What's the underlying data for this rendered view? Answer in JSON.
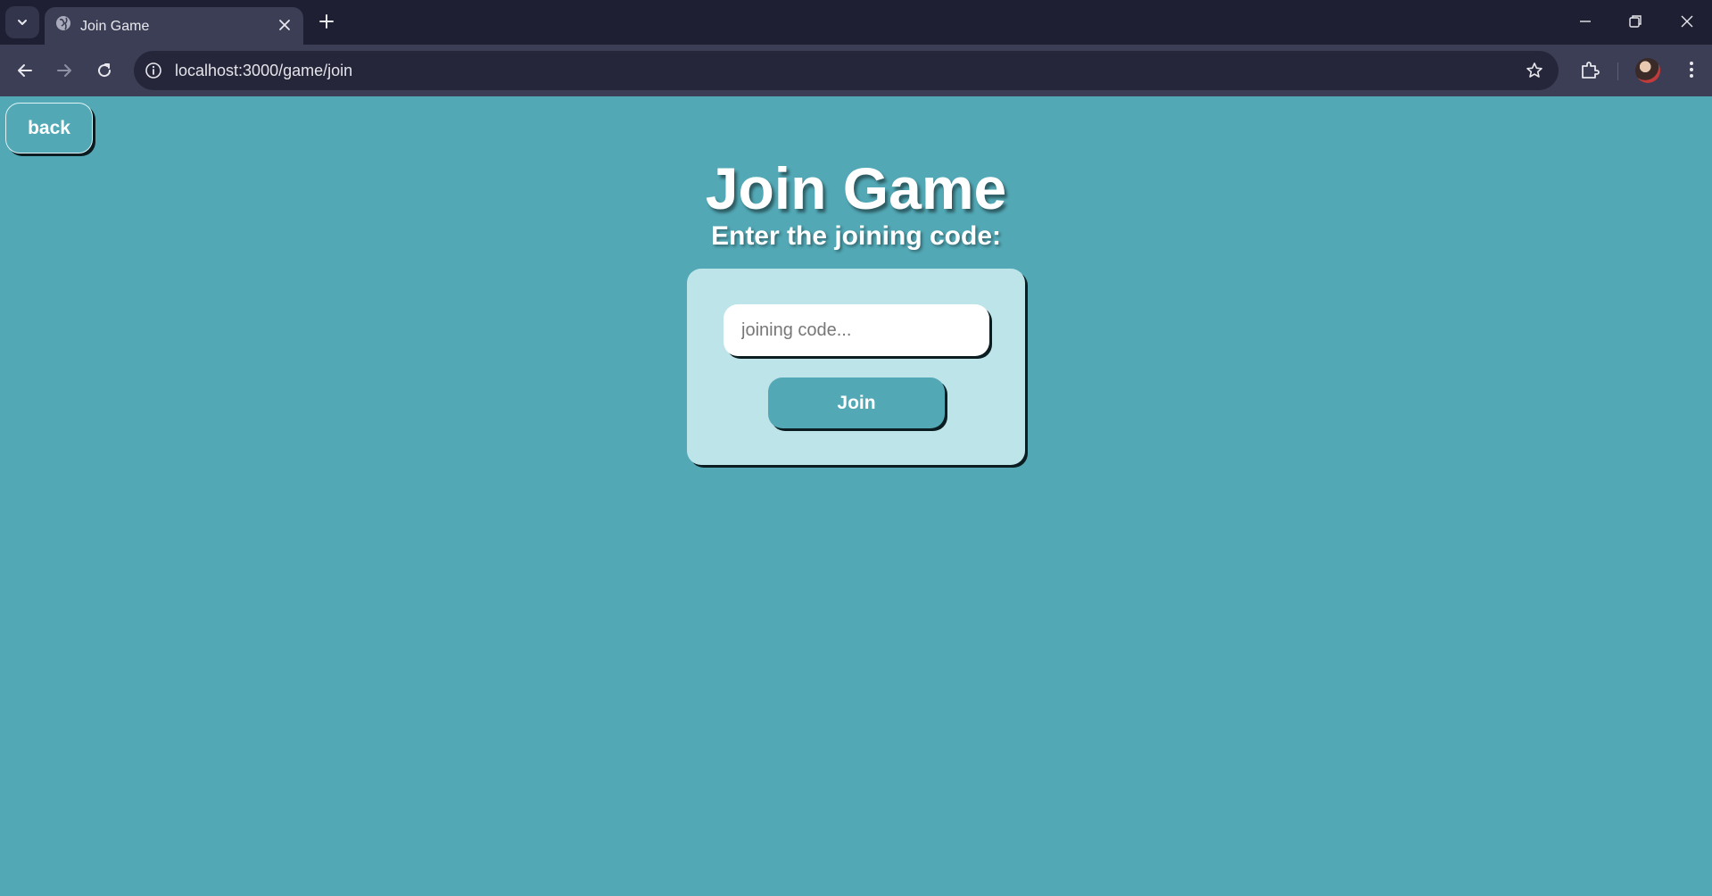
{
  "browser": {
    "tab": {
      "title": "Join Game"
    },
    "address_bar": {
      "url": "localhost:3000/game/join"
    }
  },
  "page": {
    "back_label": "back",
    "title": "Join Game",
    "subtitle": "Enter the joining code:",
    "form": {
      "code_placeholder": "joining code...",
      "code_value": "",
      "join_label": "Join"
    }
  },
  "colors": {
    "page_background": "#52a8b5",
    "card_background": "#bce4e9",
    "button_background": "#52a8b5",
    "browser_frame": "#1e1f33",
    "browser_toolbar": "#3c3e55"
  },
  "icons": {
    "tab_search": "chevron-down-icon",
    "favicon": "globe-icon",
    "tab_close": "close-icon",
    "new_tab": "plus-icon",
    "back": "arrow-left-icon",
    "forward": "arrow-right-icon",
    "reload": "reload-icon",
    "site_info": "info-icon",
    "bookmark": "star-icon",
    "extensions": "puzzle-icon",
    "profile": "avatar",
    "menu": "kebab-menu-icon",
    "minimize": "minimize-icon",
    "restore": "restore-icon",
    "close_window": "close-window-icon"
  }
}
